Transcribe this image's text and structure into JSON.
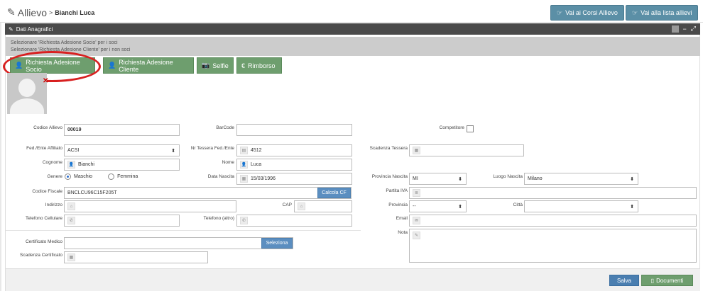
{
  "header": {
    "title": "Allievo",
    "separator": ">",
    "breadcrumb": "Bianchi Luca",
    "btn_corsi": "Vai ai Corsi Allievo",
    "btn_lista": "Vai alla lista allievi"
  },
  "panel": {
    "title": "Dati Anagrafici",
    "info_line1": "Selezionare 'Richiesta Adesione Socio' per i soci",
    "info_line2": "Selezionare 'Richiesta Adesione Cliente' per i non soci"
  },
  "actions": {
    "socio": "Richiesta Adesione Socio",
    "cliente": "Richiesta Adesione Cliente",
    "selfie": "Selfie",
    "rimborso": "Rimborso"
  },
  "form": {
    "codice_allievo": {
      "label": "Codice Allievo",
      "value": "00019"
    },
    "barcode": {
      "label": "BarCode",
      "value": ""
    },
    "competitore": {
      "label": "Competitore",
      "checked": false
    },
    "fed_ente": {
      "label": "Fed./Ente Affiliato",
      "value": "ACSI"
    },
    "nr_tessera": {
      "label": "Nr Tessera Fed./Ente",
      "value": "4512"
    },
    "scadenza_tessera": {
      "label": "Scadenza Tessera",
      "value": ""
    },
    "cognome": {
      "label": "Cognome",
      "value": "Bianchi"
    },
    "nome": {
      "label": "Nome",
      "value": "Luca"
    },
    "genere": {
      "label": "Genere",
      "opt1": "Maschio",
      "opt2": "Femmina",
      "selected": "Maschio"
    },
    "data_nascita": {
      "label": "Data Nascita",
      "value": "15/03/1996"
    },
    "provincia_nascita": {
      "label": "Provincia Nascita",
      "value": "MI"
    },
    "luogo_nascita": {
      "label": "Luogo Nascita",
      "value": "Milano"
    },
    "codice_fiscale": {
      "label": "Codice Fiscale",
      "value": "BNCLCU96C15F205T",
      "button": "Calcola CF"
    },
    "partita_iva": {
      "label": "Partita IVA",
      "value": ""
    },
    "indirizzo": {
      "label": "Indirizzo",
      "value": ""
    },
    "cap": {
      "label": "CAP",
      "value": ""
    },
    "provincia": {
      "label": "Provincia",
      "value": "--"
    },
    "citta": {
      "label": "Città",
      "value": ""
    },
    "tel_cellulare": {
      "label": "Telefono Cellulare",
      "value": ""
    },
    "tel_altro": {
      "label": "Telefono (altro)",
      "value": ""
    },
    "email": {
      "label": "Email",
      "value": ""
    },
    "nota": {
      "label": "Nota",
      "value": ""
    },
    "certificato": {
      "label": "Certificato Medico",
      "value": "",
      "button": "Seleziona"
    },
    "scadenza_certificato": {
      "label": "Scadenza Certificato",
      "value": ""
    }
  },
  "footer": {
    "salva": "Salva",
    "documenti": "Documenti"
  },
  "colors": {
    "accent_blue": "#5b8fa6",
    "green": "#6e9e6e",
    "annotation": "#d82020"
  }
}
